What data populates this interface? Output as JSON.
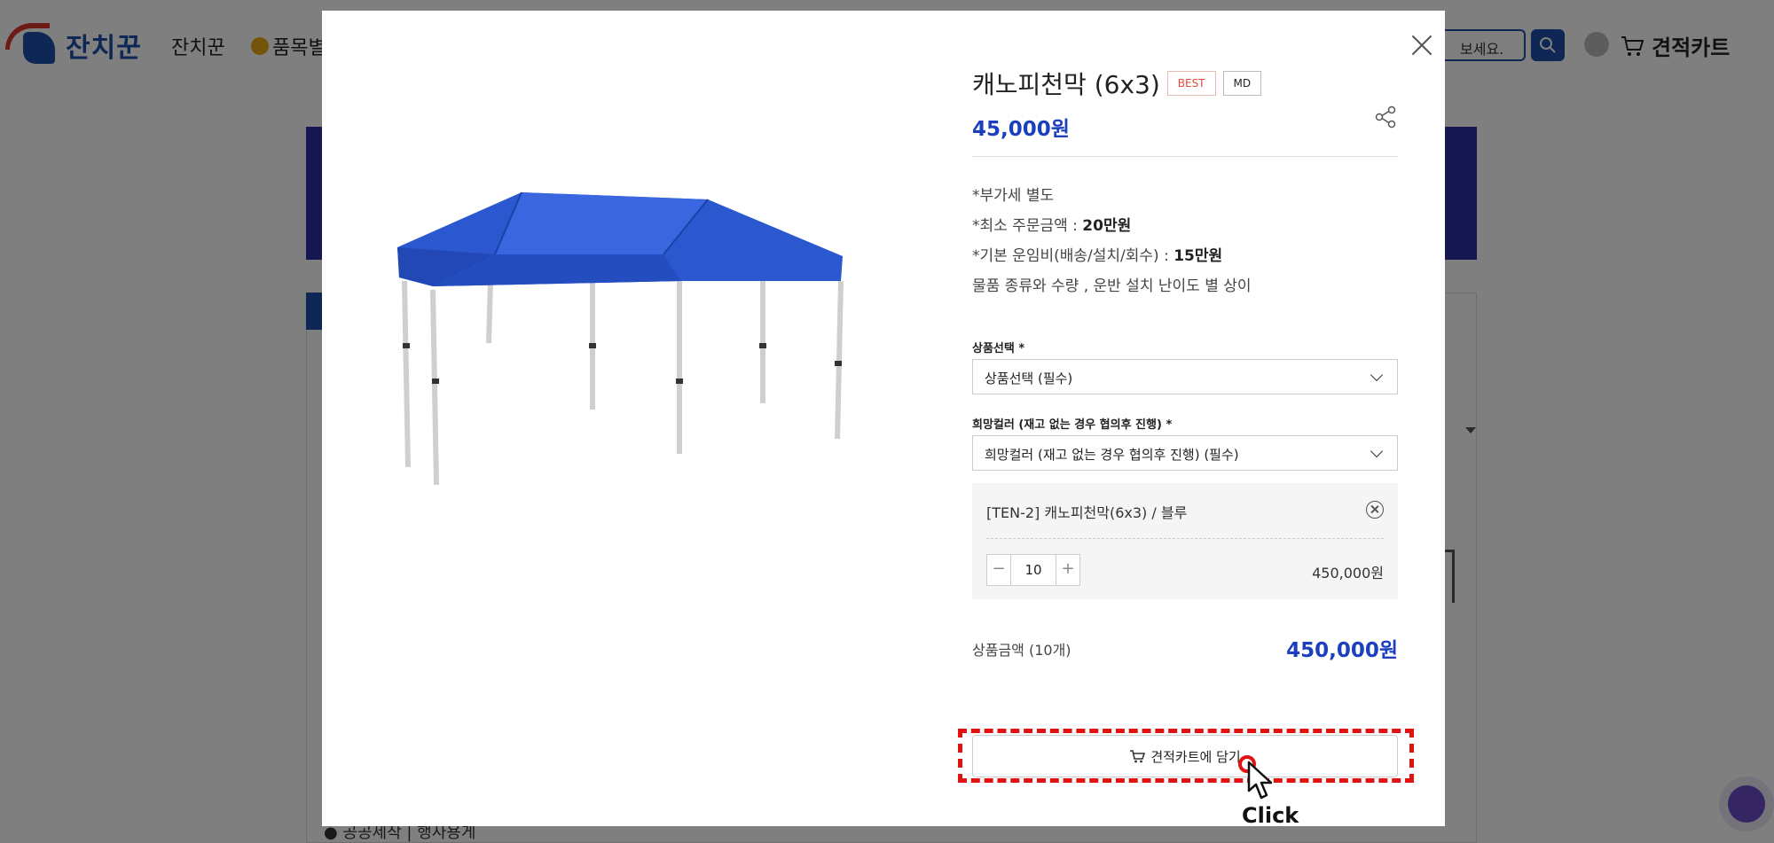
{
  "site": {
    "logo_text": "잔치꾼",
    "nav": [
      "잔치꾼",
      "품목별"
    ],
    "search_placeholder": "보세요.",
    "cart_label": "견적카트",
    "bottom_text": "● 공공세작 | 행사용게"
  },
  "modal": {
    "title": "캐노피천막 (6x3)",
    "badges": {
      "best": "BEST",
      "md": "MD"
    },
    "price": "45,000원",
    "notes": {
      "vat": "*부가세 별도",
      "min_order_prefix": "*최소 주문금액 : ",
      "min_order_value": "20만원",
      "shipping_prefix": "*기본 운임비(배송/설치/회수) : ",
      "shipping_value": "15만원",
      "extra": "물품 종류와 수량 , 운반 설치 난이도 별 상이"
    },
    "product_select": {
      "label": "상품선택 *",
      "value": "상품선택 (필수)"
    },
    "color_select": {
      "label": "희망컬러 (재고 없는 경우 협의후 진행) *",
      "value": "희망컬러 (재고 없는 경우 협의후 진행) (필수)"
    },
    "selected_option": {
      "name": "[TEN-2] 캐노피천막(6x3) / 블루",
      "quantity": "10",
      "price": "450,000원"
    },
    "total": {
      "label": "상품금액 (10개)",
      "price": "450,000원"
    },
    "cart_button": "견적카트에 담기"
  },
  "annotation": {
    "click_label": "Click"
  },
  "colors": {
    "brand_blue": "#1c3fbf",
    "highlight_red": "#e01212",
    "best_red": "#e34a3a"
  }
}
